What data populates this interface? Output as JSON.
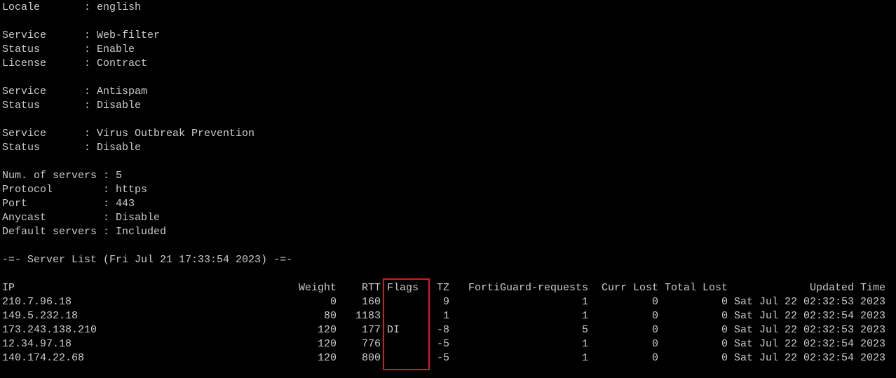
{
  "terminal": {
    "locale": {
      "key": "Locale",
      "value": "english"
    },
    "services": [
      {
        "rows": [
          {
            "key": "Service",
            "value": "Web-filter"
          },
          {
            "key": "Status",
            "value": "Enable"
          },
          {
            "key": "License",
            "value": "Contract"
          }
        ]
      },
      {
        "rows": [
          {
            "key": "Service",
            "value": "Antispam"
          },
          {
            "key": "Status",
            "value": "Disable"
          }
        ]
      },
      {
        "rows": [
          {
            "key": "Service",
            "value": "Virus Outbreak Prevention"
          },
          {
            "key": "Status",
            "value": "Disable"
          }
        ]
      }
    ],
    "settings": [
      {
        "key": "Num. of servers",
        "value": "5"
      },
      {
        "key": "Protocol",
        "value": "https"
      },
      {
        "key": "Port",
        "value": "443"
      },
      {
        "key": "Anycast",
        "value": "Disable"
      },
      {
        "key": "Default servers",
        "value": "Included"
      }
    ],
    "separator": ": ",
    "server_list_title": "-=- Server List (Fri Jul 21 17:33:54 2023) -=-",
    "server_table": {
      "headers": {
        "ip": "IP",
        "weight": "Weight",
        "rtt": "RTT",
        "flags": "Flags",
        "tz": "TZ",
        "requests": "FortiGuard-requests",
        "curr_lost": "Curr Lost",
        "total_lost": "Total Lost",
        "updated": "Updated Time"
      },
      "rows": [
        {
          "ip": "210.7.96.18",
          "weight": "0",
          "rtt": "160",
          "flags": "",
          "tz": "9",
          "requests": "1",
          "curr_lost": "0",
          "total_lost": "0",
          "updated": "Sat Jul 22 02:32:53 2023"
        },
        {
          "ip": "149.5.232.18",
          "weight": "80",
          "rtt": "1183",
          "flags": "",
          "tz": "1",
          "requests": "1",
          "curr_lost": "0",
          "total_lost": "0",
          "updated": "Sat Jul 22 02:32:54 2023"
        },
        {
          "ip": "173.243.138.210",
          "weight": "120",
          "rtt": "177",
          "flags": "DI",
          "tz": "-8",
          "requests": "5",
          "curr_lost": "0",
          "total_lost": "0",
          "updated": "Sat Jul 22 02:32:53 2023"
        },
        {
          "ip": "12.34.97.18",
          "weight": "120",
          "rtt": "776",
          "flags": "",
          "tz": "-5",
          "requests": "1",
          "curr_lost": "0",
          "total_lost": "0",
          "updated": "Sat Jul 22 02:32:54 2023"
        },
        {
          "ip": "140.174.22.68",
          "weight": "120",
          "rtt": "800",
          "flags": "",
          "tz": "-5",
          "requests": "1",
          "curr_lost": "0",
          "total_lost": "0",
          "updated": "Sat Jul 22 02:32:54 2023"
        }
      ]
    },
    "highlight_color": "#e0141e",
    "text_color": "#cccccc",
    "background_color": "#000000"
  }
}
